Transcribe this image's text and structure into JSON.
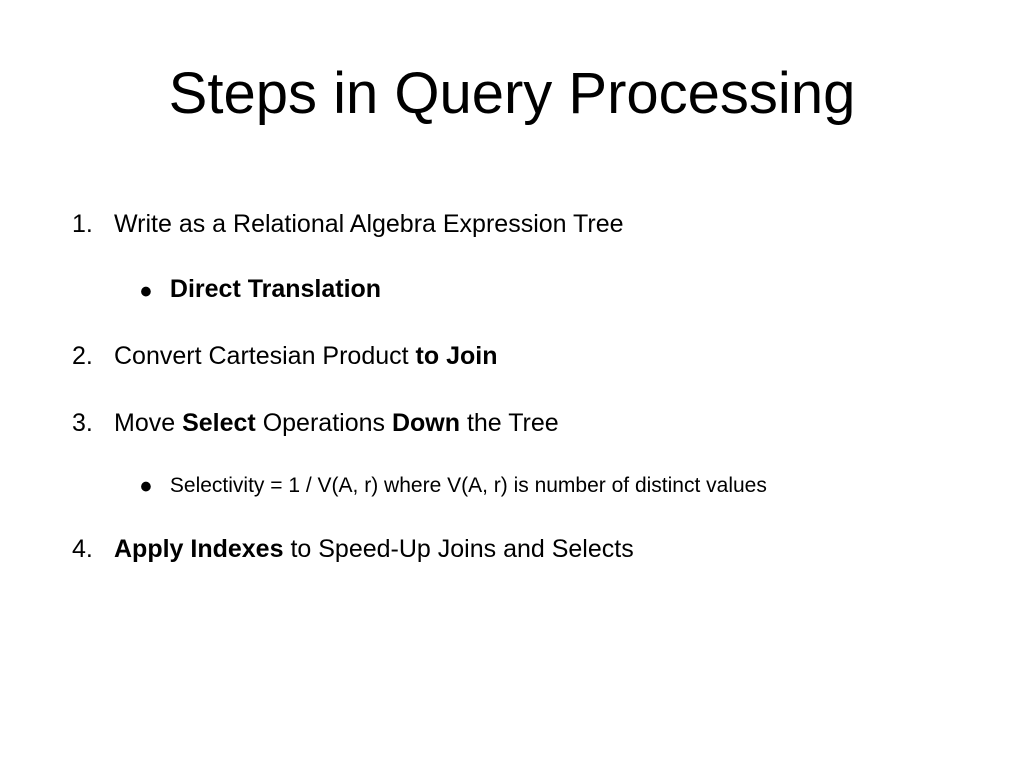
{
  "title": "Steps in Query Processing",
  "items": [
    {
      "number": "1.",
      "prefix": "Write as a Relational Algebra Expression Tree",
      "bold": "",
      "suffix": "",
      "sub": {
        "text": "Direct Translation",
        "style": "large"
      }
    },
    {
      "number": "2.",
      "prefix": "Convert Cartesian Product ",
      "bold": "to Join",
      "suffix": ""
    },
    {
      "number": "3.",
      "prefix": "Move ",
      "bold": "Select",
      "suffix": " Operations ",
      "bold2": "Down",
      "suffix2": " the Tree",
      "sub": {
        "text": "Selectivity = 1 / V(A, r)  where V(A, r) is number of distinct values",
        "style": "small"
      }
    },
    {
      "number": "4.",
      "prefix": "",
      "bold": "Apply Indexes",
      "suffix": " to Speed-Up Joins and Selects"
    }
  ]
}
